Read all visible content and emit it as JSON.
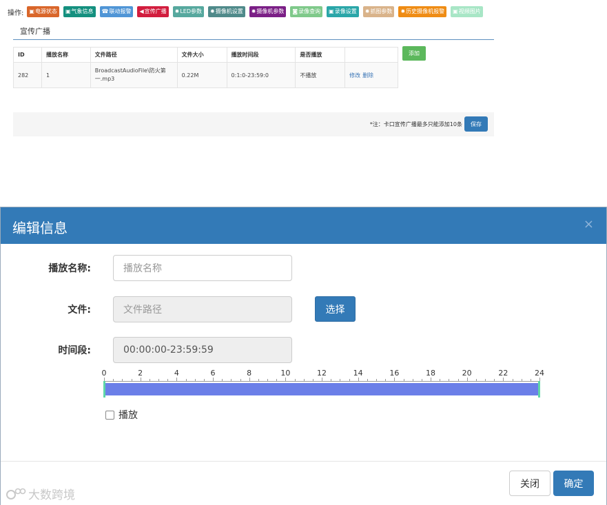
{
  "toolbar": {
    "label": "操作:",
    "buttons": [
      {
        "label": "电源状态",
        "icon": "monitor-icon",
        "glyph": "▣",
        "color": "#d9662a"
      },
      {
        "label": "气象信息",
        "icon": "monitor-icon",
        "glyph": "▣",
        "color": "#14907f"
      },
      {
        "label": "联动报警",
        "icon": "phone-icon",
        "glyph": "☎",
        "color": "#4f95d6"
      },
      {
        "label": "宣传广播",
        "icon": "bullhorn-icon",
        "glyph": "◀",
        "color": "#d21d3e"
      },
      {
        "label": "LED参数",
        "icon": "gear-icon",
        "glyph": "✹",
        "color": "#56a89e"
      },
      {
        "label": "摄像机设置",
        "icon": "gear-icon",
        "glyph": "✹",
        "color": "#4f8a8a"
      },
      {
        "label": "摄像机参数",
        "icon": "gear-icon",
        "glyph": "✹",
        "color": "#7b1f86"
      },
      {
        "label": "录像查询",
        "icon": "camera-icon",
        "glyph": "◙",
        "color": "#7fc98a"
      },
      {
        "label": "录像设置",
        "icon": "monitor-icon",
        "glyph": "▣",
        "color": "#2aa6a8"
      },
      {
        "label": "抓图参数",
        "icon": "gear-icon",
        "glyph": "✹",
        "color": "#d9b38a"
      },
      {
        "label": "历史摄像机报警",
        "icon": "gear-icon",
        "glyph": "✹",
        "color": "#ef8c14"
      },
      {
        "label": "视频图片",
        "icon": "image-icon",
        "glyph": "▣",
        "color": "#a8e6c6"
      }
    ]
  },
  "page": {
    "title": "宣传广播"
  },
  "table": {
    "headers": [
      "ID",
      "播放名称",
      "文件路径",
      "文件大小",
      "播放时间段",
      "是否播放",
      ""
    ],
    "rows": [
      {
        "id": "282",
        "name": "1",
        "path": "BroadcastAudioFile\\防火第一.mp3",
        "size": "0.22M",
        "time": "0:1:0-23:59:0",
        "play": "不播放",
        "edit": "修改",
        "delete": "删除"
      }
    ]
  },
  "actions": {
    "add": "添加",
    "note": "*注：卡口宣传广播最多只能添加10条",
    "save": "保存"
  },
  "modal": {
    "title": "编辑信息",
    "close": "×",
    "fields": {
      "name_label": "播放名称:",
      "name_placeholder": "播放名称",
      "file_label": "文件:",
      "file_placeholder": "文件路径",
      "choose": "选择",
      "time_label": "时间段:",
      "time_value": "00:00:00-23:59:59"
    },
    "timeline": {
      "ticks": [
        "0",
        "2",
        "4",
        "6",
        "8",
        "10",
        "12",
        "14",
        "16",
        "18",
        "20",
        "22",
        "24"
      ],
      "range_start_hour": 0,
      "range_end_hour": 24,
      "bar_color": "#6b7fe8",
      "handle_color": "#5fd6a7"
    },
    "play_checkbox": {
      "label": "播放",
      "checked": false
    },
    "buttons": {
      "close": "关闭",
      "ok": "确定"
    }
  },
  "watermark": {
    "text": "大数跨境"
  }
}
